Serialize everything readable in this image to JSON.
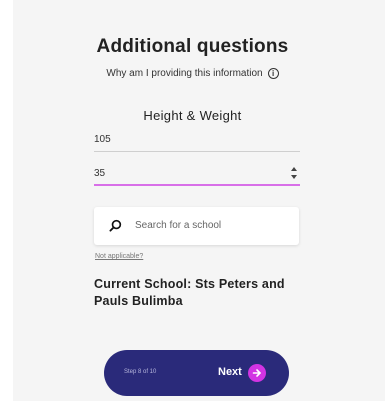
{
  "header": {
    "title": "Additional questions",
    "why_text": "Why am I providing this information",
    "info_icon": "i"
  },
  "section": {
    "heading": "Height & Weight"
  },
  "fields": {
    "height_value": "105",
    "weight_value": "35"
  },
  "search": {
    "placeholder": "Search for a school",
    "icon": "search-icon"
  },
  "not_applicable": "Not applicable?",
  "current_school": "Current School: Sts Peters and Pauls Bulimba",
  "footer": {
    "step_text": "Step 8 of 10",
    "next_label": "Next",
    "next_icon": "arrow-right-icon"
  },
  "colors": {
    "accent": "#d234e3",
    "primary_bar": "#2a2a7a",
    "focus_underline": "#d86fe8",
    "background": "#f5f5f5"
  }
}
